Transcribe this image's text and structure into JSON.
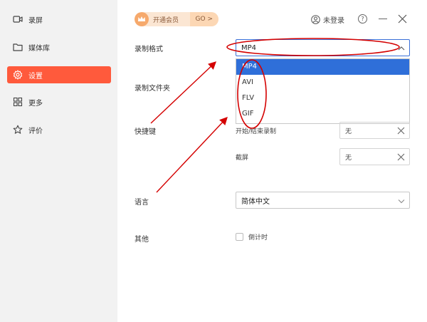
{
  "sidebar": {
    "items": [
      {
        "label": "录屏",
        "icon": "video-camera-icon"
      },
      {
        "label": "媒体库",
        "icon": "folder-icon"
      },
      {
        "label": "设置",
        "icon": "gear-icon",
        "active": true
      },
      {
        "label": "更多",
        "icon": "grid-icon"
      },
      {
        "label": "评价",
        "icon": "star-icon"
      }
    ]
  },
  "topbar": {
    "vip_label": "开通会员",
    "go_label": "GO >",
    "login_label": "未登录",
    "help_label": "?"
  },
  "settings": {
    "format_label": "录制格式",
    "format_value": "MP4",
    "format_options": [
      "MP4",
      "AVI",
      "FLV",
      "GIF"
    ],
    "folder_label": "录制文件夹",
    "hotkey_label": "快捷键",
    "hotkeys": [
      {
        "name": "开始/结束录制",
        "value": "无"
      },
      {
        "name": "截屏",
        "value": "无"
      }
    ],
    "language_label": "语言",
    "language_value": "简体中文",
    "other_label": "其他",
    "countdown_label": "倒计时"
  },
  "colors": {
    "accent": "#ff5a3c",
    "dropdown_selected": "#2f6fd9",
    "annotation": "#d40000"
  }
}
